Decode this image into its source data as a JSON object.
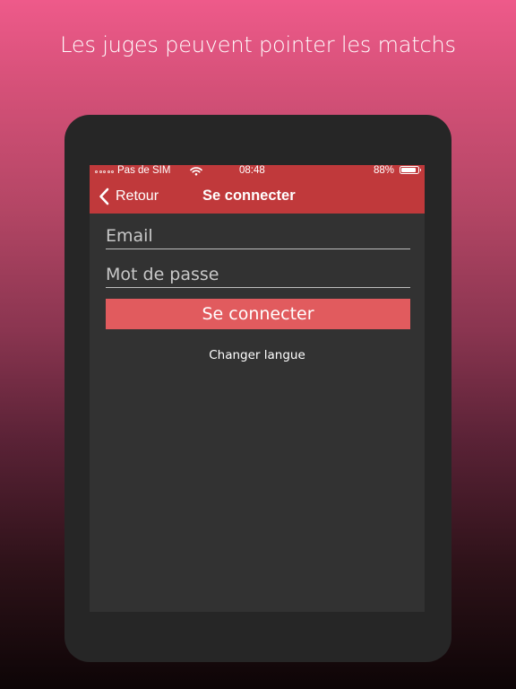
{
  "promo": {
    "tagline": "Les juges peuvent pointer les matchs"
  },
  "status_bar": {
    "carrier": "Pas de SIM",
    "time": "08:48",
    "battery_percent": "88%",
    "battery_level": 0.88,
    "signal_icon": "signal-dots-icon",
    "wifi_icon": "wifi-icon",
    "battery_icon": "battery-icon"
  },
  "nav": {
    "back_label": "Retour",
    "back_icon": "chevron-left-icon",
    "title": "Se connecter"
  },
  "form": {
    "email_placeholder": "Email",
    "email_value": "",
    "password_placeholder": "Mot de passe",
    "password_value": "",
    "submit_label": "Se connecter",
    "change_language_label": "Changer langue"
  },
  "colors": {
    "accent": "#c0393b",
    "button": "#e15b5e",
    "screen_background": "#323232",
    "device_frame": "#262626"
  }
}
